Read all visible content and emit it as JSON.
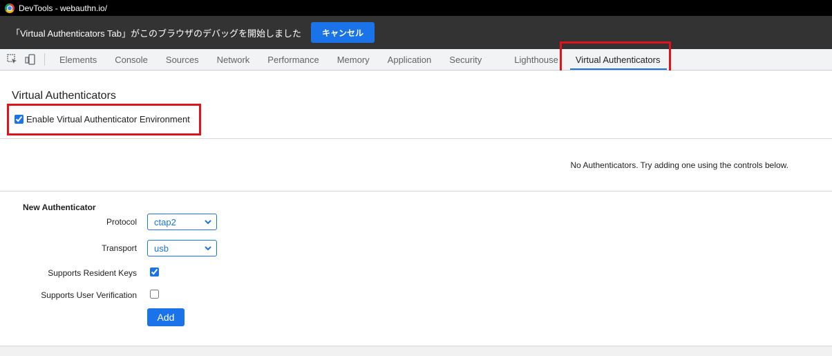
{
  "window": {
    "title": "DevTools - webauthn.io/"
  },
  "banner": {
    "message": "「Virtual Authenticators Tab」がこのブラウザのデバッグを開始しました",
    "cancel_label": "キャンセル"
  },
  "tabs": [
    {
      "label": "Elements"
    },
    {
      "label": "Console"
    },
    {
      "label": "Sources"
    },
    {
      "label": "Network"
    },
    {
      "label": "Performance"
    },
    {
      "label": "Memory"
    },
    {
      "label": "Application"
    },
    {
      "label": "Security"
    },
    {
      "label": "Lighthouse"
    },
    {
      "label": "Virtual Authenticators",
      "active": true
    }
  ],
  "panel": {
    "heading": "Virtual Authenticators",
    "enable_label": "Enable Virtual Authenticator Environment",
    "enable_checked": true,
    "empty_message": "No Authenticators. Try adding one using the controls below."
  },
  "new_authenticator": {
    "title": "New Authenticator",
    "protocol_label": "Protocol",
    "protocol_value": "ctap2",
    "transport_label": "Transport",
    "transport_value": "usb",
    "resident_keys_label": "Supports Resident Keys",
    "resident_keys_checked": true,
    "user_verification_label": "Supports User Verification",
    "user_verification_checked": false,
    "add_label": "Add"
  },
  "colors": {
    "accent": "#1a73e8",
    "highlight": "#e0131d",
    "banner": "#333333"
  }
}
